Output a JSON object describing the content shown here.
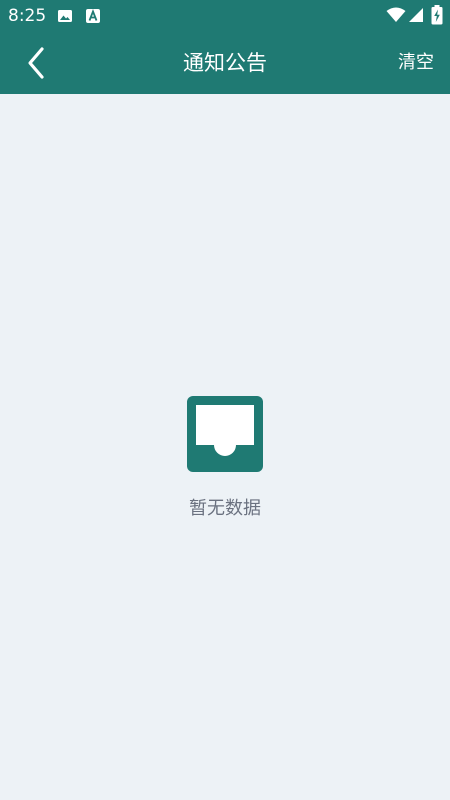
{
  "status_bar": {
    "time": "8:25",
    "icons": [
      "image-notification-icon",
      "a-notification-icon",
      "wifi-icon",
      "cellular-signal-icon",
      "battery-charging-icon"
    ]
  },
  "header": {
    "title": "通知公告",
    "back_icon": "chevron-left-icon",
    "action_label": "清空"
  },
  "empty_state": {
    "icon": "empty-inbox-icon",
    "message": "暂无数据"
  },
  "colors": {
    "header_bg": "#1f7a73",
    "page_bg": "#edf2f6",
    "empty_text": "#6b7280",
    "accent": "#1f7a73"
  }
}
